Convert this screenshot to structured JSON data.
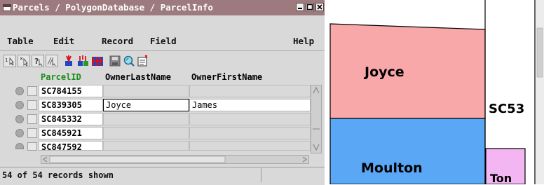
{
  "window": {
    "title": "Parcels / PolygonDatabase / ParcelInfo",
    "controls": [
      "minimize-icon",
      "maximize-icon",
      "close-icon"
    ]
  },
  "menu": {
    "table": "Table",
    "edit": "Edit",
    "record": "Record",
    "field": "Field",
    "help": "Help"
  },
  "toolbar": {
    "buttons": [
      "single-record-view-icon",
      "insert-record-icon",
      "query-icon",
      "edit-field-icon",
      "select-records-icon",
      "multi-select-icon",
      "highlight-records-icon",
      "save-icon",
      "search-icon",
      "export-icon"
    ]
  },
  "grid": {
    "columns": [
      "ParcelID",
      "OwnerLastName",
      "OwnerFirstName"
    ],
    "rows": [
      {
        "parcel_id": "SC784155",
        "last": "",
        "first": ""
      },
      {
        "parcel_id": "SC839305",
        "last": "Joyce",
        "first": "James"
      },
      {
        "parcel_id": "SC845332",
        "last": "",
        "first": ""
      },
      {
        "parcel_id": "SC845921",
        "last": "",
        "first": ""
      },
      {
        "parcel_id": "SC847592",
        "last": "",
        "first": ""
      }
    ],
    "selected_row": 1
  },
  "status": {
    "text": "54 of 54 records shown"
  },
  "map": {
    "labels": {
      "joyce": "Joyce",
      "moulton": "Moulton",
      "sc53": "SC53",
      "ton": "Ton"
    },
    "colors": {
      "joyce_fill": "#f8a8a8",
      "moulton_fill": "#59a7f5",
      "ton_fill": "#f4b6f2",
      "boundary": "#000000"
    }
  },
  "colors": {
    "titlebar": "#9c7a7d",
    "panel": "#d9d9d9",
    "header_text": "#1a8c1a"
  }
}
